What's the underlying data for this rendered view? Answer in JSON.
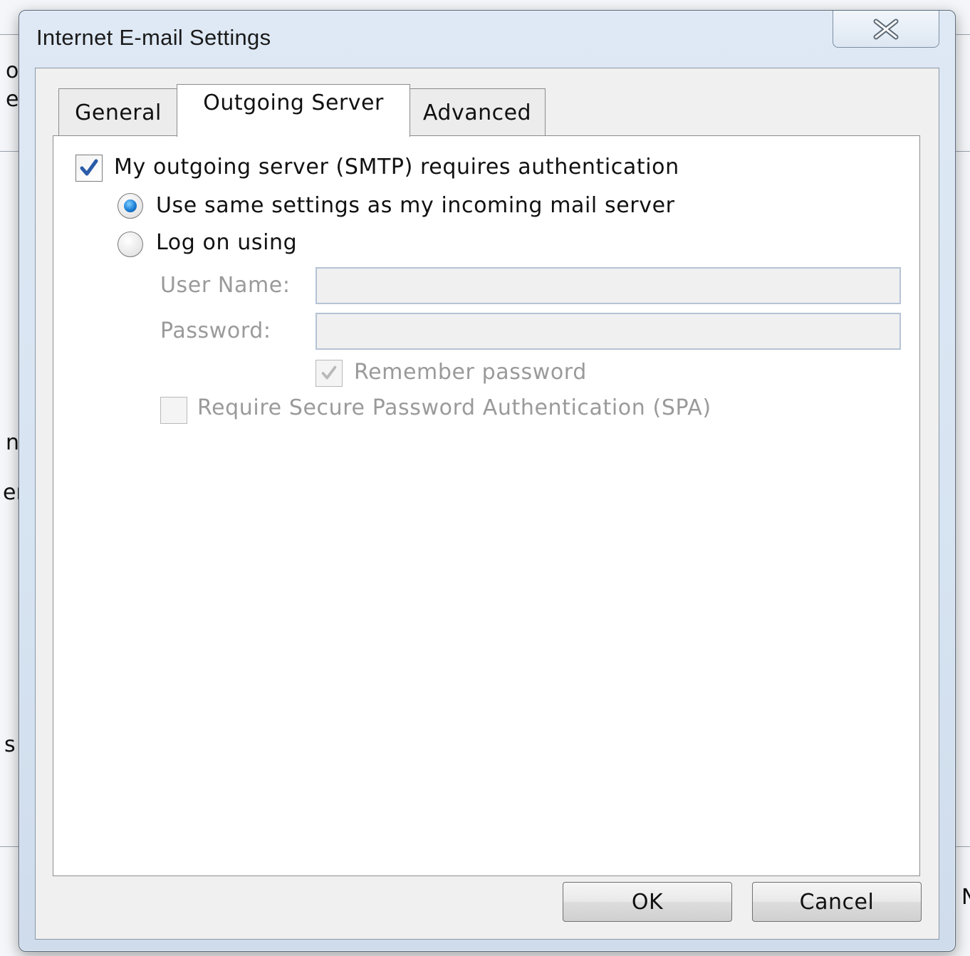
{
  "dialog": {
    "title": "Internet E-mail Settings"
  },
  "tabs": [
    {
      "label": "General"
    },
    {
      "label": "Outgoing Server"
    },
    {
      "label": "Advanced"
    }
  ],
  "outgoing": {
    "smtp_auth_label": "My outgoing server (SMTP) requires authentication",
    "smtp_auth_checked": true,
    "use_same_label": "Use same settings as my incoming mail server",
    "use_same_selected": true,
    "log_on_label": "Log on using",
    "log_on_selected": false,
    "username_label": "User Name:",
    "username_value": "",
    "password_label": "Password:",
    "password_value": "",
    "remember_label": "Remember password",
    "remember_checked": true,
    "spa_label": "Require Secure Password Authentication (SPA)",
    "spa_checked": false
  },
  "buttons": {
    "ok": "OK",
    "cancel": "Cancel"
  },
  "background_fragments": [
    "o",
    "e",
    "n",
    "er",
    "s",
    "N"
  ],
  "colors": {
    "dialog_frame": "#d6e3f1",
    "radio_selected": "#1c7fd6",
    "checkmark": "#2a5aa8",
    "disabled_text": "#9a9a9a"
  }
}
